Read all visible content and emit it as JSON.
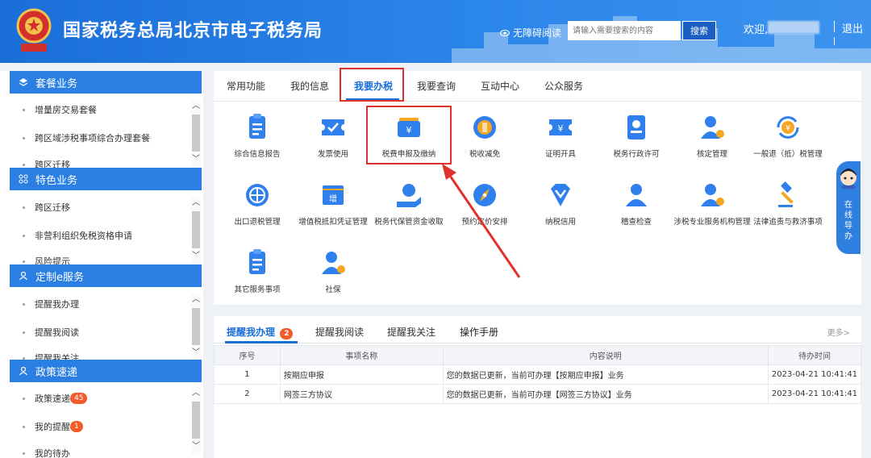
{
  "header": {
    "title": "国家税务总局北京市电子税务局",
    "accessibility": "无障碍阅读",
    "search_placeholder": "请输入需要搜索的内容",
    "search_button": "搜索",
    "welcome": "欢迎,",
    "logout": "退出"
  },
  "sidebar": {
    "sections": [
      {
        "title": "套餐业务",
        "items": [
          "增量房交易套餐",
          "跨区域涉税事项综合办理套餐",
          "跨区迁移"
        ]
      },
      {
        "title": "特色业务",
        "items": [
          "跨区迁移",
          "非营利组织免税资格申请",
          "风险提示"
        ]
      },
      {
        "title": "定制e服务",
        "items": [
          "提醒我办理",
          "提醒我阅读",
          "提醒我关注"
        ]
      },
      {
        "title": "政策速递",
        "items": [
          "政策速递",
          "我的提醒",
          "我的待办"
        ],
        "badges": [
          "45",
          "1"
        ]
      }
    ]
  },
  "main": {
    "tabs": [
      "常用功能",
      "我的信息",
      "我要办税",
      "我要查询",
      "互动中心",
      "公众服务"
    ],
    "grid": [
      "综合信息报告",
      "发票使用",
      "税费申报及缴纳",
      "税收减免",
      "证明开具",
      "税务行政许可",
      "核定管理",
      "一般退（抵）税管理",
      "出口退税管理",
      "增值税抵扣凭证管理",
      "税务代保管资金收取",
      "预约定价安排",
      "纳税信用",
      "稽查检查",
      "涉税专业服务机构管理",
      "法律追责与救济事项",
      "其它服务事项",
      "社保"
    ],
    "grid_icon_text": {
      "ticket": "增",
      "coin": "¥"
    }
  },
  "reminders": {
    "tabs": [
      "提醒我办理",
      "提醒我阅读",
      "提醒我关注",
      "操作手册"
    ],
    "badge": "2",
    "more": "更多>",
    "columns": [
      "序号",
      "事项名称",
      "内容说明",
      "待办时间"
    ],
    "rows": [
      {
        "no": "1",
        "name": "按期应申报",
        "desc": "您的数据已更新，当前可办理【按期应申报】业务",
        "time": "2023-04-21 10:41:41"
      },
      {
        "no": "2",
        "name": "网签三方协议",
        "desc": "您的数据已更新，当前可办理【网签三方协议】业务",
        "time": "2023-04-21 10:41:41"
      }
    ]
  },
  "guide": {
    "text": "在线导办"
  },
  "colors": {
    "primary": "#1a6ed8",
    "accent": "#2b7fe2",
    "highlight": "#e0312f",
    "badge": "#f25c2b"
  }
}
